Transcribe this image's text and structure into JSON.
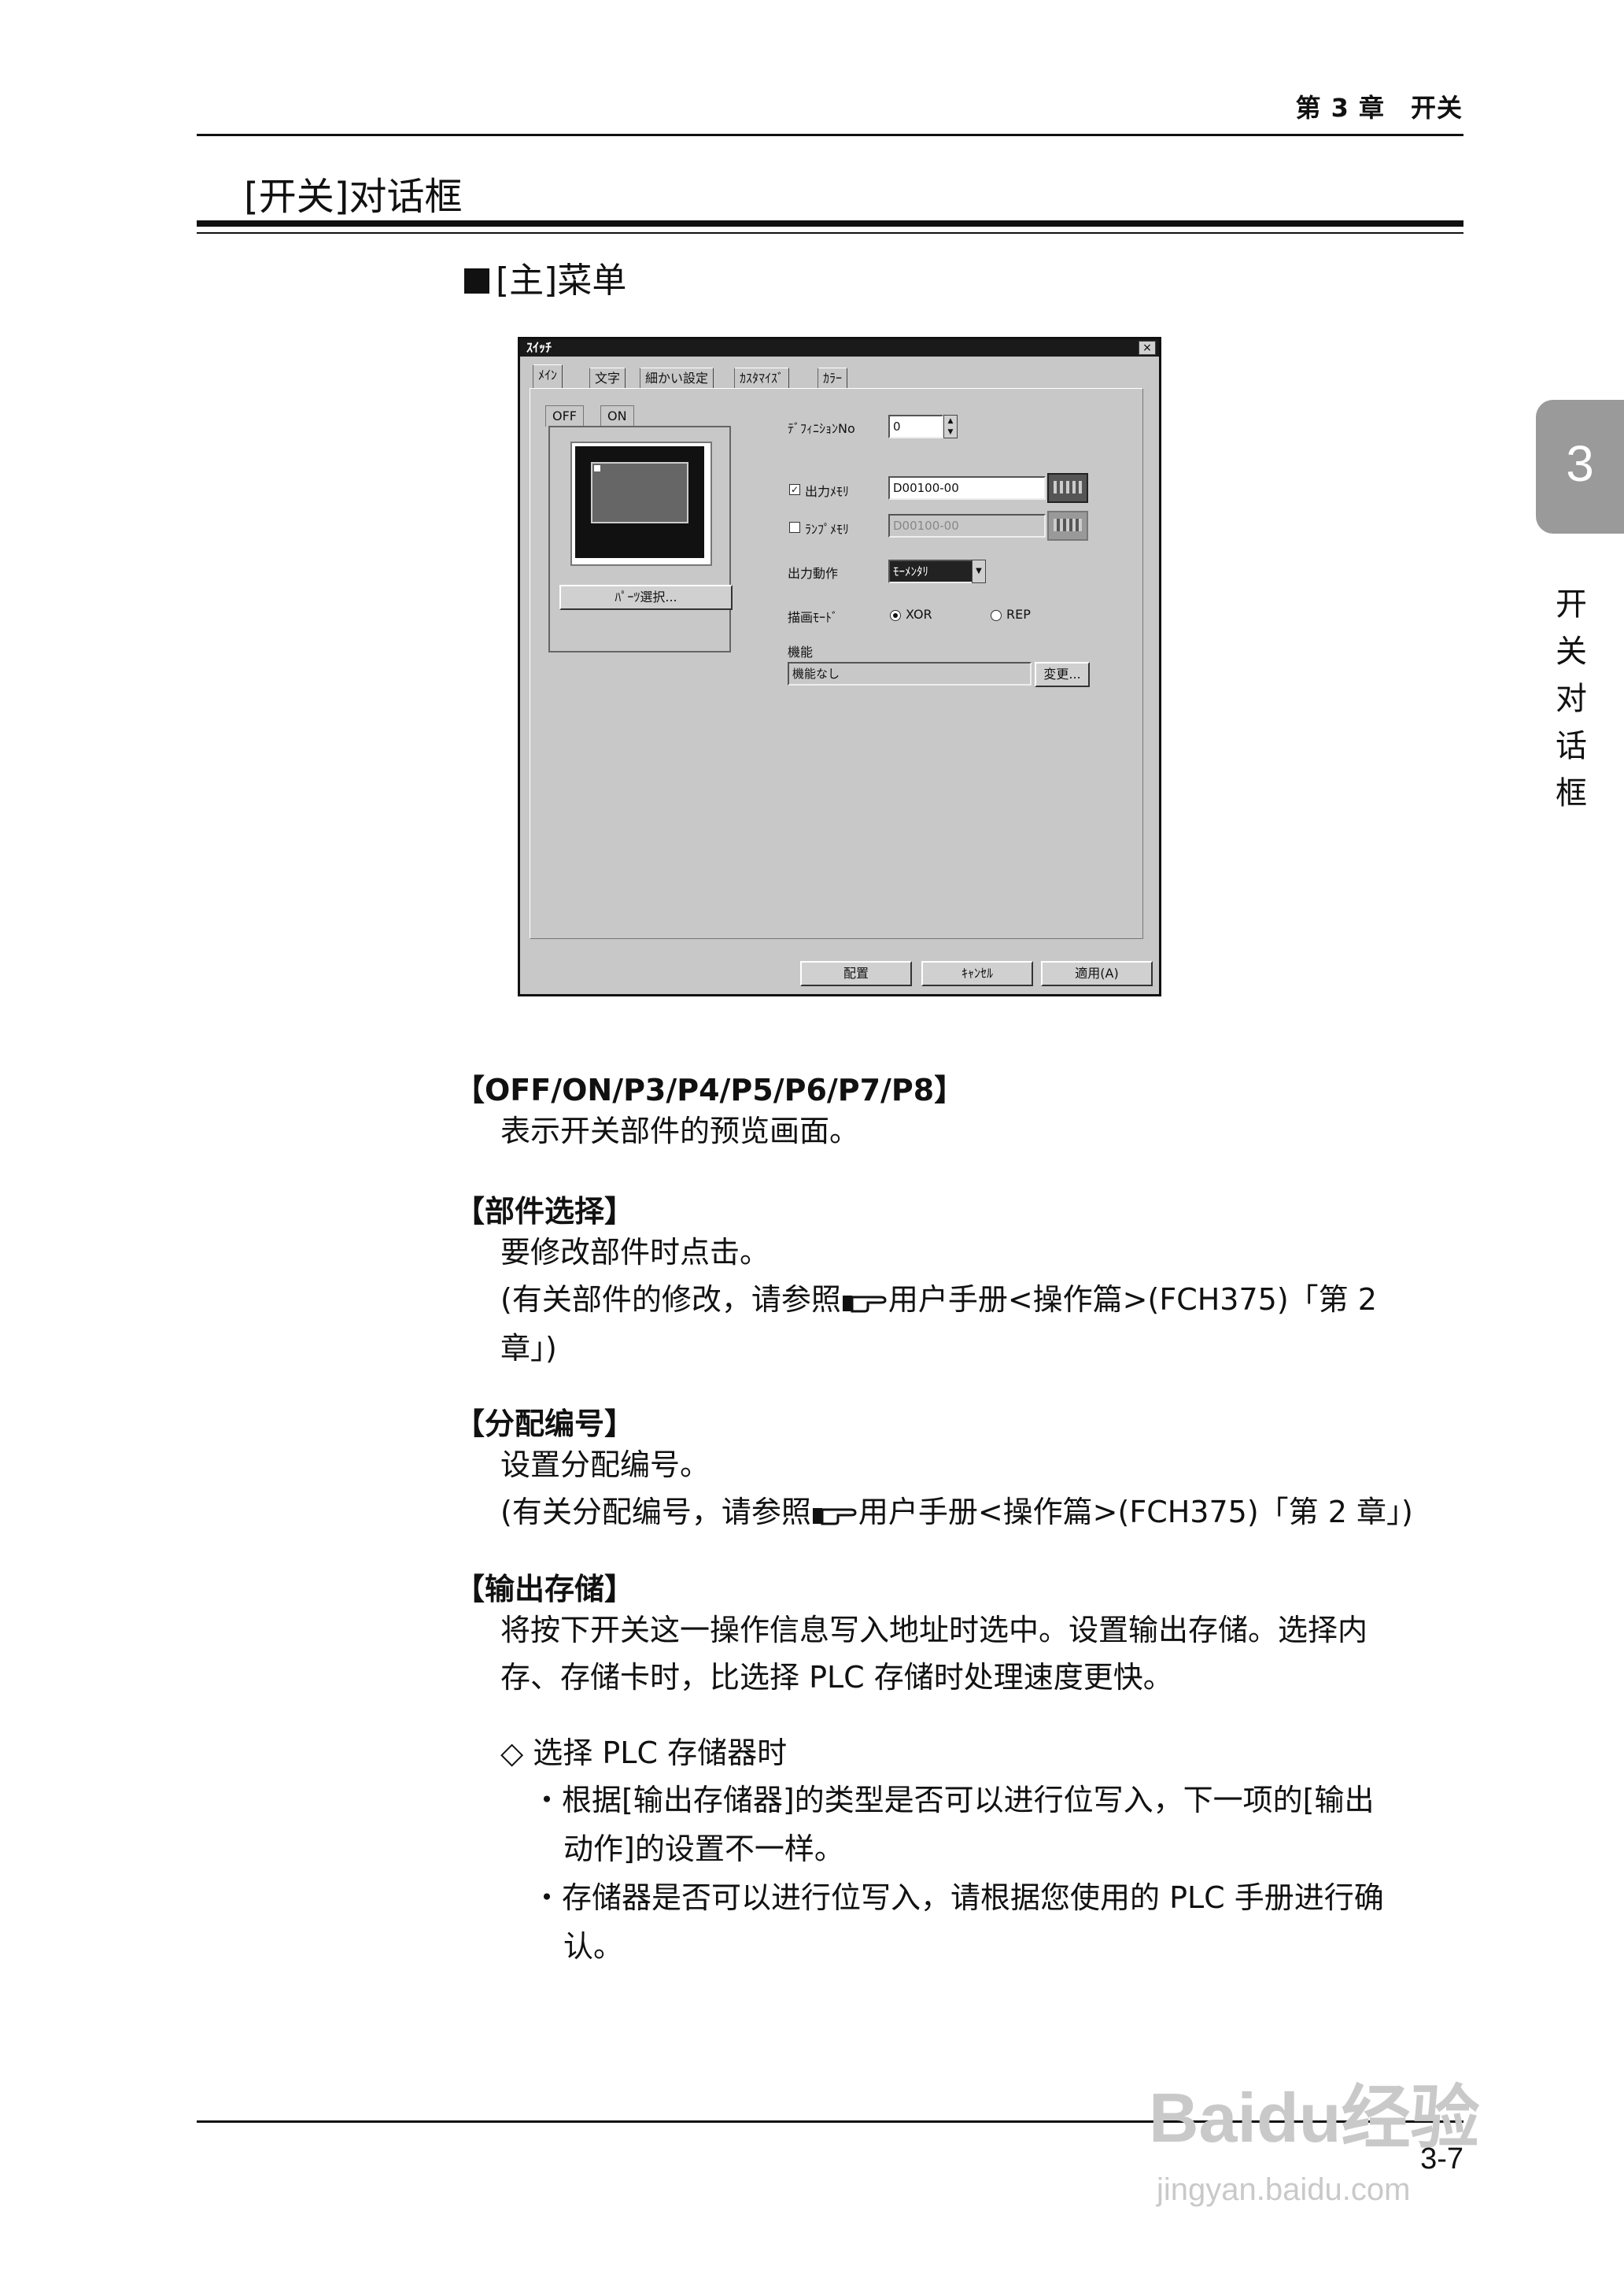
{
  "header": {
    "running_title": "第 3 章　开关"
  },
  "section_title": "[开关]对话框",
  "subsection_title": "[主]菜单",
  "chapter_tab": {
    "number": "3",
    "vertical_text": "开关对话框"
  },
  "dialog": {
    "title": "ｽｲｯﾁ",
    "close_label": "×",
    "tabs": [
      "ﾒｲﾝ",
      "文字",
      "細かい設定",
      "ｶｽﾀﾏｲｽﾞ",
      "ｶﾗｰ"
    ],
    "state_tabs": [
      "OFF",
      "ON"
    ],
    "parts_select_button": "ﾊﾟｰﾂ選択...",
    "definition_no_label": "ﾃﾞﾌｨﾆｼｮﾝNo",
    "definition_no_value": "0",
    "output_memory": {
      "label": "出力ﾒﾓﾘ",
      "checked": true,
      "value": "D00100-00"
    },
    "lamp_memory": {
      "label": "ﾗﾝﾌﾟﾒﾓﾘ",
      "checked": false,
      "value": "D00100-00"
    },
    "output_action": {
      "label": "出力動作",
      "value": "ﾓｰﾒﾝﾀﾘ"
    },
    "draw_mode": {
      "label": "描画ﾓｰﾄﾞ",
      "options": [
        "XOR",
        "REP"
      ],
      "selected": "XOR"
    },
    "function": {
      "label": "機能",
      "value": "機能なし",
      "change_button": "変更..."
    },
    "footer_buttons": [
      "配置",
      "ｷｬﾝｾﾙ",
      "適用(A)"
    ]
  },
  "entries": [
    {
      "title": "【OFF/ON/P3/P4/P5/P6/P7/P8】",
      "lines": [
        "表示开关部件的预览画面。"
      ]
    },
    {
      "title": "【部件选择】",
      "lines": [
        "要修改部件时点击。",
        "(有关部件的修改，请参照",
        "用户手册<操作篇>(FCH375)「第 2",
        "章」)"
      ]
    },
    {
      "title": "【分配编号】",
      "lines": [
        "设置分配编号。",
        "(有关分配编号，请参照",
        "用户手册<操作篇>(FCH375)「第 2 章」)"
      ]
    },
    {
      "title": "【输出存储】",
      "lines": [
        "将按下开关这一操作信息写入地址时选中。设置输出存储。选择内",
        "存、存储卡时，比选择 PLC 存储时处理速度更快。"
      ]
    }
  ],
  "subnote": {
    "title": "◇ 选择 PLC 存储器时",
    "bullets": [
      [
        "根据[输出存储器]的类型是否可以进行位写入，下一项的[输出",
        "动作]的设置不一样。"
      ],
      [
        "存储器是否可以进行位写入，请根据您使用的 PLC 手册进行确",
        "认。"
      ]
    ]
  },
  "page_number": "3-7",
  "watermark": {
    "main": "Baidu经验",
    "url": "jingyan.baidu.com"
  }
}
